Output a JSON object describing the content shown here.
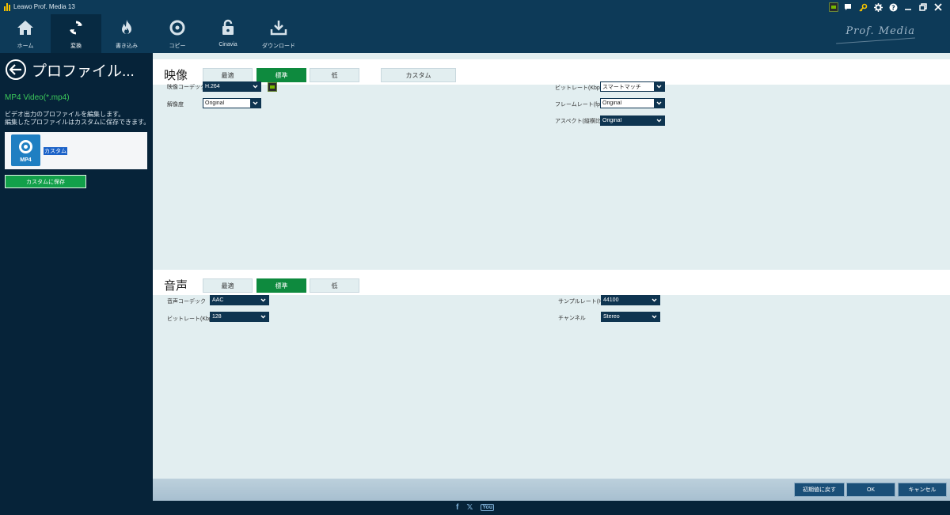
{
  "app": {
    "title": "Leawo Prof. Media 13",
    "brand": "Prof. Media"
  },
  "window_controls": [
    "gpu-icon",
    "chat-icon",
    "key-icon",
    "gear-icon",
    "help-icon",
    "minimize-icon",
    "restore-icon",
    "close-icon"
  ],
  "tabs": [
    {
      "label": "ホーム",
      "icon": "home-icon",
      "active": false
    },
    {
      "label": "変換",
      "icon": "convert-icon",
      "active": true
    },
    {
      "label": "書き込み",
      "icon": "burn-icon",
      "active": false
    },
    {
      "label": "コピー",
      "icon": "copy-icon",
      "active": false
    },
    {
      "label": "Cinavia",
      "icon": "unlock-icon",
      "active": false
    },
    {
      "label": "ダウンロード",
      "icon": "download-icon",
      "active": false
    }
  ],
  "left": {
    "title": "プロファイル...",
    "format": "MP4 Video(*.mp4)",
    "description": "ビデオ出力のプロファイルを編集します。\n編集したプロファイルはカスタムに保存できます。",
    "profile_badge": "MP4",
    "profile_label": "カスタム",
    "save_button": "カスタムに保存"
  },
  "video": {
    "title": "映像",
    "quality": [
      "最適",
      "標準",
      "低"
    ],
    "custom": "カスタム",
    "codec_label": "映像コーデック",
    "codec": "H.264",
    "resolution_label": "解像度",
    "resolution": "Original",
    "bitrate_label": "ビットレート(Kbps)",
    "bitrate": "スマートマッチ",
    "framerate_label": "フレームレート(fps)",
    "framerate": "Original",
    "aspect_label": "アスペクト(縦横比)",
    "aspect": "Original"
  },
  "audio": {
    "title": "音声",
    "quality": [
      "最適",
      "標準",
      "低"
    ],
    "codec_label": "音声コーデック",
    "codec": "AAC",
    "bitrate_label": "ビットレート(Kbps)",
    "bitrate": "128",
    "samplerate_label": "サンプルレート(Hz)",
    "samplerate": "44100",
    "channel_label": "チャンネル",
    "channel": "Stereo"
  },
  "actions": {
    "reset": "初期値に戻す",
    "ok": "OK",
    "cancel": "キャンセル"
  },
  "social": [
    "f",
    "𝕏",
    "You"
  ],
  "colors": {
    "topbar": "#0d3a58",
    "sidebar": "#062339",
    "accent_green": "#0e8a3e",
    "content_bg": "#e2eef0"
  }
}
